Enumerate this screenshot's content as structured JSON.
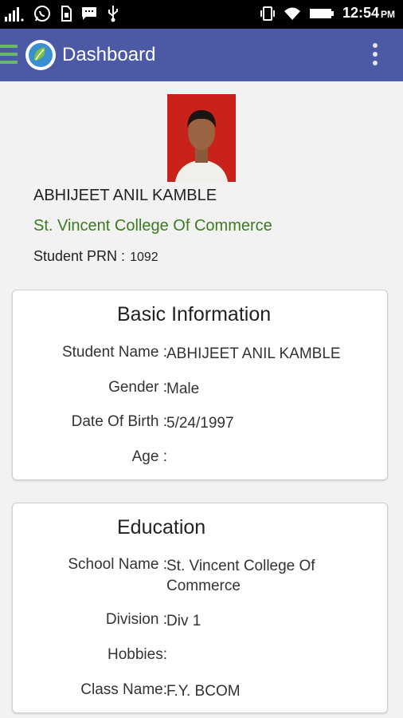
{
  "status_bar": {
    "time": "12:54",
    "ampm": "PM"
  },
  "app_bar": {
    "title": "Dashboard"
  },
  "profile": {
    "name": "ABHIJEET ANIL KAMBLE",
    "college": "St. Vincent College Of Commerce",
    "prn_label": "Student PRN :",
    "prn_value": "1092"
  },
  "basic_info": {
    "title": "Basic Information",
    "rows": [
      {
        "label": "Student Name :",
        "value": "ABHIJEET ANIL KAMBLE"
      },
      {
        "label": "Gender :",
        "value": "Male"
      },
      {
        "label": "Date Of Birth :",
        "value": "5/24/1997"
      },
      {
        "label": "Age :",
        "value": ""
      }
    ]
  },
  "education": {
    "title": "Education",
    "rows": [
      {
        "label": "School Name :",
        "value": "St. Vincent College Of Commerce"
      },
      {
        "label": "Division :",
        "value": "Div 1"
      },
      {
        "label": "Hobbies:",
        "value": ""
      },
      {
        "label": "Class Name:",
        "value": "F.Y. BCOM"
      }
    ]
  },
  "colors": {
    "app_bar": "#4c5aa6",
    "college_text": "#3c7a1e",
    "photo_bg": "#c8221b"
  }
}
